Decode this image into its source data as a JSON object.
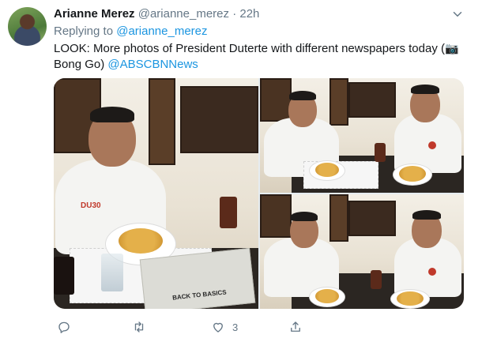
{
  "tweet": {
    "display_name": "Arianne Merez",
    "handle": "@arianne_merez",
    "separator": "·",
    "timestamp": "22h",
    "reply": {
      "prefix": "Replying to",
      "to": "@arianne_merez"
    },
    "text": {
      "main": "LOOK: More photos of President Duterte with different newspapers today  (",
      "camera_icon": "📷",
      "credit": " Bong Go) ",
      "mention": "@ABSCBNNews"
    },
    "media": {
      "photo_count": 3,
      "shirt_text": "DU30",
      "newspaper_text": "BACK TO BASICS"
    },
    "actions": {
      "like_count": "3"
    }
  },
  "colors": {
    "link": "#1b95e0",
    "secondary_text": "#657786",
    "primary_text": "#14171a"
  },
  "icons": [
    "chevron-down-icon",
    "reply-icon",
    "retweet-icon",
    "like-icon",
    "share-icon",
    "camera-icon"
  ]
}
